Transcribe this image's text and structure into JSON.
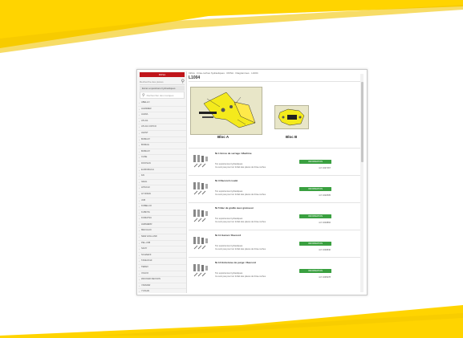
{
  "colors": {
    "accent_yellow": "#ffd400",
    "brand_red": "#c0151b",
    "info_green": "#3aa040"
  },
  "sidebar": {
    "brand_button": "ROSA",
    "search_placeholder": "Recherche des pièces",
    "active_category": "Ecran expositions hydrauliques",
    "brand_search_placeholder": "Rechercher des marques",
    "brands": [
      "ABELLO",
      "AGRIMER",
      "AGRIA",
      "ATLAS",
      "ATLAS COPCO",
      "AVANT",
      "BOBCAT",
      "BOMAG",
      "BOBCAT",
      "CASE",
      "DOOSAN",
      "EUROMACH",
      "FAI",
      "GEHL",
      "HITACHI",
      "HYUNDAI",
      "JCB",
      "KOBELCO",
      "KUBOTA",
      "KOMATSU",
      "LIEBHERR",
      "MECALAC",
      "NEW HOLLAND",
      "PEL-JOB",
      "SANY",
      "SCHAEFF",
      "TAKEUCHI",
      "TEREX",
      "VOLVO",
      "WACKER NEUSON",
      "YANMAR",
      "YUCHAI",
      "ZOOMLION",
      "CATERPILLAR",
      "DEERE",
      "LONKING"
    ]
  },
  "main": {
    "breadcrumb": "Infinis · brise-roches hydrauliques · ROSA · Diagrammes · L1004",
    "title": "L1004",
    "diagram_a_label": "Bloc A",
    "diagram_b_label": "Bloc B",
    "parts": [
      {
        "name": "Nr.1 Ecrou de serrage / Machine",
        "desc1": "Ton expériences hydrauliques",
        "desc2": "Ce sont pas pour ton forfait des pièces de brise-roches",
        "button": "INFORMATION",
        "ref": "réf: 1027167"
      },
      {
        "name": "Nr.3 Raccord coudé",
        "desc1": "Ton expériences hydrauliques",
        "desc2": "Ce sont pas pour ton forfait des pièces de brise-roches",
        "button": "INFORMATION",
        "ref": "réf: 1022505"
      },
      {
        "name": "Nr.5 Bac de graille avec graisseur",
        "desc1": "Ton expériences hydrauliques",
        "desc2": "Ce sont pas pour ton forfait des pièces de brise-roches",
        "button": "INFORMATION",
        "ref": "réf: 1023802"
      },
      {
        "name": "Nr.11 Garnet / Raccord",
        "desc1": "Ton expériences hydrauliques",
        "desc2": "Ce sont pas pour ton forfait des pièces de brise-roches",
        "button": "INFORMATION",
        "ref": "réf: 1026840"
      },
      {
        "name": "Nr.14 Entretoise de purge / Raccord",
        "desc1": "Ton expériences hydrauliques",
        "desc2": "Ce sont pas pour ton forfait des pièces de brise-roches",
        "button": "INFORMATION",
        "ref": "réf: 1025278"
      }
    ]
  },
  "icons": {
    "search": "search-icon",
    "scroll": "scrollbar"
  }
}
